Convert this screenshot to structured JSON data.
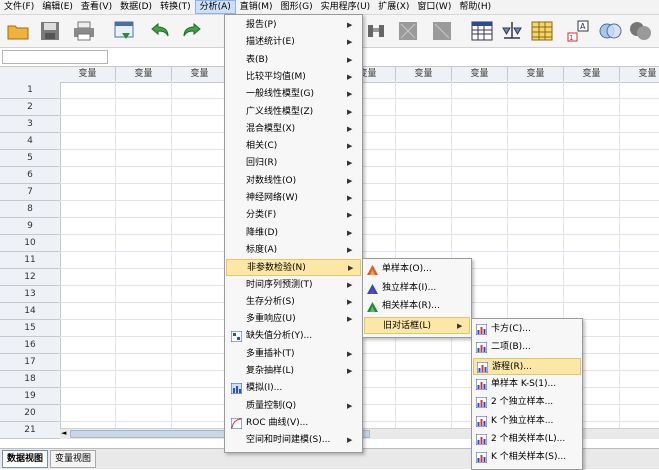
{
  "menubar": [
    {
      "label": "文件(F)",
      "active": false
    },
    {
      "label": "编辑(E)",
      "active": false
    },
    {
      "label": "查看(V)",
      "active": false
    },
    {
      "label": "数据(D)",
      "active": false
    },
    {
      "label": "转换(T)",
      "active": false
    },
    {
      "label": "分析(A)",
      "active": true
    },
    {
      "label": "直销(M)",
      "active": false
    },
    {
      "label": "图形(G)",
      "active": false
    },
    {
      "label": "实用程序(U)",
      "active": false
    },
    {
      "label": "扩展(X)",
      "active": false
    },
    {
      "label": "窗口(W)",
      "active": false
    },
    {
      "label": "帮助(H)",
      "active": false
    }
  ],
  "grid": {
    "column_header": "变量",
    "rows": [
      "1",
      "2",
      "3",
      "4",
      "5",
      "6",
      "7",
      "8",
      "9",
      "10",
      "11",
      "12",
      "13",
      "14",
      "15",
      "16",
      "17",
      "18",
      "19",
      "20",
      "21"
    ]
  },
  "analyze_menu": [
    {
      "label": "报告(P)",
      "arrow": true
    },
    {
      "label": "描述统计(E)",
      "arrow": true
    },
    {
      "label": "表(B)",
      "arrow": true
    },
    {
      "label": "比较平均值(M)",
      "arrow": true
    },
    {
      "label": "一般线性模型(G)",
      "arrow": true
    },
    {
      "label": "广义线性模型(Z)",
      "arrow": true
    },
    {
      "label": "混合模型(X)",
      "arrow": true
    },
    {
      "label": "相关(C)",
      "arrow": true
    },
    {
      "label": "回归(R)",
      "arrow": true
    },
    {
      "label": "对数线性(O)",
      "arrow": true
    },
    {
      "label": "神经网络(W)",
      "arrow": true
    },
    {
      "label": "分类(F)",
      "arrow": true
    },
    {
      "label": "降维(D)",
      "arrow": true
    },
    {
      "label": "标度(A)",
      "arrow": true
    },
    {
      "label": "非参数检验(N)",
      "arrow": true,
      "highlight": true
    },
    {
      "label": "时间序列预测(T)",
      "arrow": true
    },
    {
      "label": "生存分析(S)",
      "arrow": true
    },
    {
      "label": "多重响应(U)",
      "arrow": true
    },
    {
      "label": "缺失值分析(Y)...",
      "arrow": false,
      "icon": "missing-value-icon"
    },
    {
      "label": "多重插补(T)",
      "arrow": true
    },
    {
      "label": "复杂抽样(L)",
      "arrow": true
    },
    {
      "label": "模拟(I)...",
      "arrow": false,
      "icon": "simulation-icon"
    },
    {
      "label": "质量控制(Q)",
      "arrow": true
    },
    {
      "label": "ROC 曲线(V)...",
      "arrow": false,
      "icon": "roc-curve-icon"
    },
    {
      "label": "空间和时间建模(S)...",
      "arrow": true
    }
  ],
  "nonparam_menu": [
    {
      "label": "单样本(O)...",
      "icon": "one-sample-icon",
      "arrow": false
    },
    {
      "label": "独立样本(I)...",
      "icon": "independent-samples-icon",
      "arrow": false
    },
    {
      "label": "相关样本(R)...",
      "icon": "related-samples-icon",
      "arrow": false
    },
    {
      "label": "旧对话框(L)",
      "arrow": true,
      "highlight": true
    }
  ],
  "legacy_menu": [
    {
      "label": "卡方(C)...",
      "icon": "chi-square-icon"
    },
    {
      "label": "二项(B)...",
      "icon": "binomial-icon"
    },
    {
      "label": "游程(R)...",
      "icon": "runs-icon",
      "highlight": true
    },
    {
      "label": "单样本 K-S(1)...",
      "icon": "ks-one-sample-icon"
    },
    {
      "label": "2 个独立样本...",
      "icon": "two-independent-icon"
    },
    {
      "label": "K 个独立样本...",
      "icon": "k-independent-icon"
    },
    {
      "label": "2 个相关样本(L)...",
      "icon": "two-related-icon"
    },
    {
      "label": "K 个相关样本(S)...",
      "icon": "k-related-icon"
    }
  ],
  "tabs": [
    {
      "label": "数据视图",
      "selected": true
    },
    {
      "label": "变量视图",
      "selected": false
    }
  ]
}
